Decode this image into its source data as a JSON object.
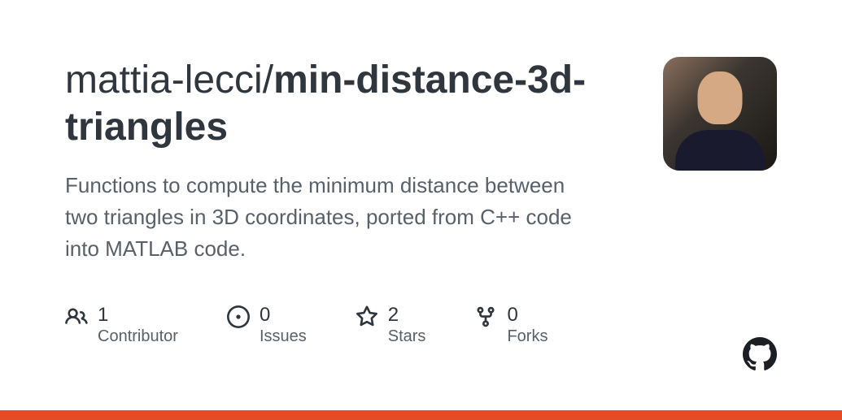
{
  "repo": {
    "owner": "mattia-lecci",
    "name": "min-distance-3d-triangles",
    "description": "Functions to compute the minimum distance between two triangles in 3D coordinates, ported from C++ code into MATLAB code."
  },
  "stats": {
    "contributors": {
      "value": "1",
      "label": "Contributor"
    },
    "issues": {
      "value": "0",
      "label": "Issues"
    },
    "stars": {
      "value": "2",
      "label": "Stars"
    },
    "forks": {
      "value": "0",
      "label": "Forks"
    }
  },
  "accent_color": "#e34c26"
}
